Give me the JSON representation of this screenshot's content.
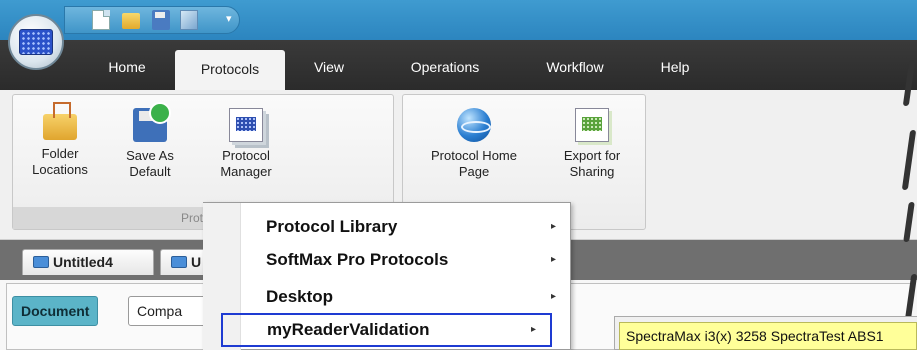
{
  "tabs": [
    {
      "label": "Home",
      "active": false
    },
    {
      "label": "Protocols",
      "active": true
    },
    {
      "label": "View",
      "active": false
    },
    {
      "label": "Operations",
      "active": false
    },
    {
      "label": "Workflow",
      "active": false
    },
    {
      "label": "Help",
      "active": false
    }
  ],
  "ribbon": {
    "group1": {
      "label": "Protocol",
      "buttons": [
        {
          "line1": "Folder",
          "line2": "Locations",
          "icon": "folder-tree-icon"
        },
        {
          "line1": "Save As",
          "line2": "Default",
          "icon": "save-check-icon"
        },
        {
          "line1": "Protocol",
          "line2": "Manager",
          "icon": "plate-stack-icon"
        }
      ]
    },
    "group2": {
      "buttons": [
        {
          "line1": "Protocol Home",
          "line2": "Page",
          "icon": "globe-icon"
        },
        {
          "line1": "Export for",
          "line2": "Sharing",
          "icon": "plate-export-icon"
        }
      ]
    }
  },
  "document_tabs": [
    {
      "label": "Untitled4"
    },
    {
      "label": "U"
    }
  ],
  "content": {
    "document_button": "Document",
    "compare_button": "Compa"
  },
  "menu": {
    "items": [
      {
        "label": "Protocol Library",
        "arrow": "▸"
      },
      {
        "label": "SoftMax Pro Protocols",
        "arrow": "▸"
      },
      {
        "label": "Desktop",
        "arrow": "▸"
      },
      {
        "label": "myReaderValidation",
        "arrow": "▸"
      }
    ],
    "submenu_item": "SpectraMax i3(x) 3258 SpectraTest ABS1"
  },
  "qat": {
    "dropdown": "▾"
  },
  "colors": {
    "qat_blue": "#2c85bf",
    "tab_bar": "#2b2b2b",
    "highlight_border": "#1e3bd2",
    "submenu_yellow": "#ffff99",
    "document_active": "#5bb4c8"
  }
}
